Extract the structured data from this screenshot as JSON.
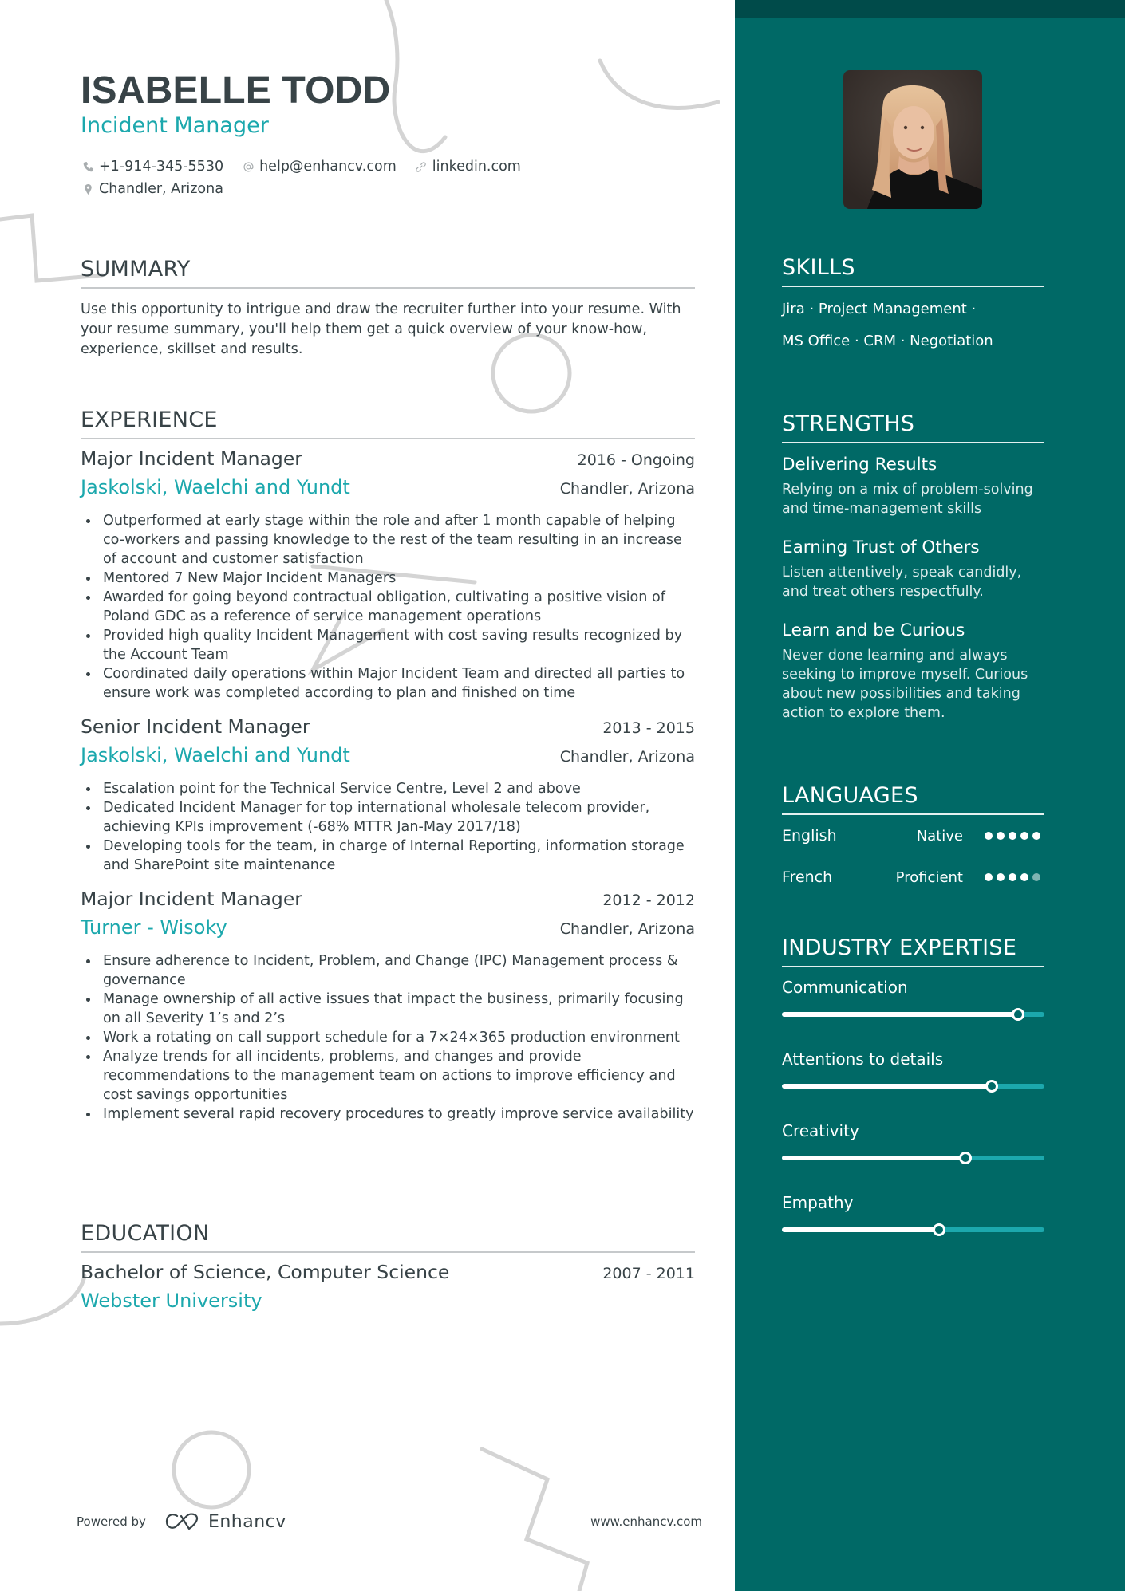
{
  "header": {
    "name": "ISABELLE TODD",
    "title": "Incident Manager",
    "contacts": [
      {
        "icon": "phone-icon",
        "text": "+1-914-345-5530"
      },
      {
        "icon": "at-icon",
        "text": "help@enhancv.com"
      },
      {
        "icon": "link-icon",
        "text": "linkedin.com"
      },
      {
        "icon": "location-pin-icon",
        "text": "Chandler, Arizona"
      }
    ]
  },
  "summary": {
    "heading": "SUMMARY",
    "text": "Use this opportunity to intrigue and draw the recruiter further into your resume. With your resume summary, you'll help them get a quick overview of your know-how, experience, skillset and results."
  },
  "experience": {
    "heading": "EXPERIENCE",
    "jobs": [
      {
        "role": "Major Incident Manager",
        "dates": "2016 - Ongoing",
        "company": "Jaskolski, Waelchi and Yundt",
        "location": "Chandler, Arizona",
        "bullets": [
          "Outperformed at early stage within the role and after 1 month capable of helping co-workers and passing knowledge to the rest of the team resulting in an increase of account and customer satisfaction",
          "Mentored 7 New Major Incident Managers",
          "Awarded for going beyond contractual obligation, cultivating a positive vision of Poland GDC as a reference of service management operations",
          "Provided high quality Incident Management with cost saving results recognized by the Account Team",
          "Coordinated daily operations within Major Incident Team and directed all parties to ensure work was completed according to plan and finished on time"
        ]
      },
      {
        "role": "Senior Incident Manager",
        "dates": "2013 - 2015",
        "company": "Jaskolski, Waelchi and Yundt",
        "location": "Chandler, Arizona",
        "bullets": [
          "Escalation point for the Technical Service Centre, Level 2 and above",
          "Dedicated Incident Manager for top international wholesale telecom provider, achieving KPIs improvement (-68% MTTR Jan-May 2017/18)",
          "Developing tools for the team, in charge of Internal Reporting, information storage and SharePoint site maintenance"
        ]
      },
      {
        "role": "Major Incident Manager",
        "dates": "2012 - 2012",
        "company": "Turner - Wisoky",
        "location": "Chandler, Arizona",
        "bullets": [
          "Ensure adherence to Incident, Problem, and Change (IPC) Management process & governance",
          "Manage ownership of all active issues that impact the business, primarily focusing on all Severity 1’s and 2’s",
          "Work a rotating on call support schedule for a 7×24×365 production environment",
          "Analyze trends for all incidents, problems, and changes and provide recommendations to the management team on actions to improve efficiency and cost savings opportunities",
          "Implement several rapid recovery procedures to greatly improve service availability"
        ]
      }
    ]
  },
  "education": {
    "heading": "EDUCATION",
    "items": [
      {
        "degree": "Bachelor of Science, Computer Science",
        "dates": "2007 - 2011",
        "school": "Webster University"
      }
    ]
  },
  "footer": {
    "powered_by": "Powered by",
    "brand": "Enhancv",
    "url": "www.enhancv.com"
  },
  "sidebar": {
    "photo_alt": "Profile photo of Isabelle Todd",
    "skills": {
      "heading": "SKILLS",
      "lines": [
        "Jira · Project Management ·",
        "MS Office · CRM · Negotiation"
      ]
    },
    "strengths": {
      "heading": "STRENGTHS",
      "items": [
        {
          "title": "Delivering Results",
          "description": "Relying on a mix of problem-solving and time-management skills"
        },
        {
          "title": "Earning Trust of Others",
          "description": "Listen attentively, speak candidly, and treat others respectfully."
        },
        {
          "title": "Learn and be Curious",
          "description": "Never done learning and always seeking to improve myself. Curious about new possibilities and taking action to explore them."
        }
      ]
    },
    "languages": {
      "heading": "LANGUAGES",
      "items": [
        {
          "name": "English",
          "level": "Native",
          "rating": 5,
          "max": 5
        },
        {
          "name": "French",
          "level": "Proficient",
          "rating": 4,
          "max": 5
        }
      ]
    },
    "expertise": {
      "heading": "INDUSTRY EXPERTISE",
      "items": [
        {
          "label": "Communication",
          "value": 0.9
        },
        {
          "label": "Attentions to details",
          "value": 0.8
        },
        {
          "label": "Creativity",
          "value": 0.7
        },
        {
          "label": "Empathy",
          "value": 0.6
        }
      ]
    }
  },
  "colors": {
    "accent": "#1ca8ad",
    "sidebar": "#006966",
    "sidebar_band": "#004b4a",
    "text": "#384347"
  }
}
